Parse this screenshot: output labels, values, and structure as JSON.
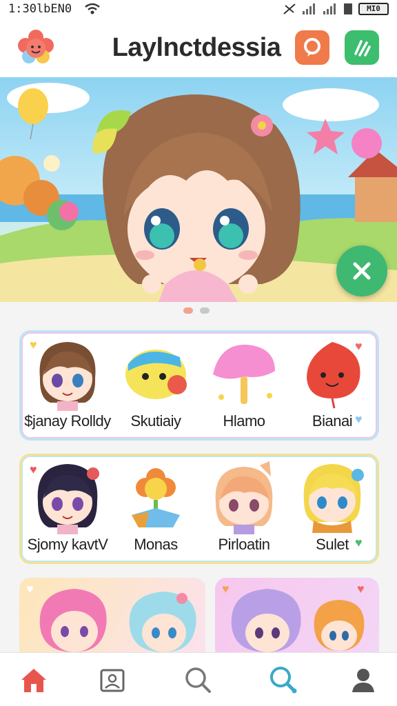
{
  "status_bar": {
    "time": "1:30lbEN0",
    "battery": "MI0"
  },
  "header": {
    "title": "Laylnctdessia"
  },
  "carousel": {
    "page_count": 2,
    "active_index": 0
  },
  "row1": [
    {
      "name": "$janay Rolldy"
    },
    {
      "name": "Skutiaiy"
    },
    {
      "name": "Hlamo"
    },
    {
      "name": "Bianai"
    }
  ],
  "row2": [
    {
      "name": "Sjomy kavtV"
    },
    {
      "name": "Monas"
    },
    {
      "name": "Pirloatin"
    },
    {
      "name": "Sulet"
    }
  ],
  "colors": {
    "orange_button": "#f07a4a",
    "green_button": "#3dbd6e",
    "fab": "#3fb872",
    "nav_active": "#e8554e",
    "nav_highlight": "#39a9c7"
  },
  "nav": {
    "items": [
      {
        "icon": "home-icon",
        "active": true
      },
      {
        "icon": "gallery-icon",
        "active": false
      },
      {
        "icon": "search-icon",
        "active": false
      },
      {
        "icon": "discover-icon",
        "active": false
      },
      {
        "icon": "profile-icon",
        "active": false
      }
    ]
  }
}
